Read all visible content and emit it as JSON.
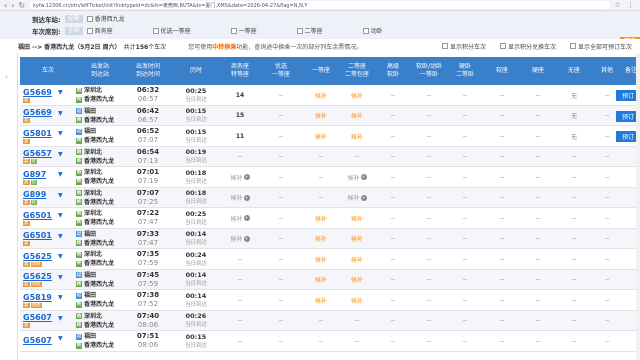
{
  "browser": {
    "url": "kyfw.12306.cn/otn/leftTicket/init?linktypeid=dc&fs=東莞西,BUTA&ts=夏门,XMS&date=2026-04-27&flag=N,N,Y"
  },
  "filters": {
    "arrival_label": "到达车站:",
    "arrival_tag": "全部",
    "arrival_option": "香港西九龙",
    "seat_label": "车次席别:",
    "seat_tag": "全部",
    "seat_options": [
      "商务座",
      "优选一等座",
      "一等座",
      "二等座",
      "动卧"
    ],
    "filter_button": "筛选"
  },
  "summary": {
    "route": "福田 --> 香港西九龙（5月2日 周六）",
    "count_prefix": "共计",
    "count": "156",
    "count_suffix": "个车次",
    "tip_prefix": "您可使用",
    "tip_highlight": "中转换乘",
    "tip_suffix": "功能，查询途中换乘一次的部分列车余票情况。",
    "options": [
      "显示积分车次",
      "显示积分兑换车次",
      "显示全部可预订车次"
    ]
  },
  "columns": [
    "车次",
    "出发站\n到达站",
    "出发时间\n到达时间",
    "历时",
    "商务座\n特等座",
    "优选\n一等座",
    "一等座",
    "二等座\n二等包座",
    "高级\n软卧",
    "软卧/动卧\n一等卧",
    "硬卧\n二等卧",
    "软座",
    "硬座",
    "无座",
    "其他",
    "备注"
  ],
  "rows": [
    {
      "train": "G5669",
      "tags": [
        "复"
      ],
      "from": "深圳北",
      "to": "香港西九龙",
      "dep": "06:32",
      "arr": "06:57",
      "dur": "00:25",
      "day": "当日到达",
      "seats": [
        "14",
        "--",
        "候补",
        "候补",
        "--",
        "--",
        "--",
        "--",
        "--",
        "无",
        "--"
      ],
      "book": "预订"
    },
    {
      "train": "G5669",
      "tags": [
        "复"
      ],
      "from": "福田",
      "to": "香港西九龙",
      "dep": "06:42",
      "arr": "06:57",
      "dur": "00:15",
      "day": "当日到达",
      "seats": [
        "15",
        "--",
        "候补",
        "候补",
        "--",
        "--",
        "--",
        "--",
        "--",
        "无",
        "--"
      ],
      "book": "预订"
    },
    {
      "train": "G5801",
      "tags": [
        "复"
      ],
      "from": "福田",
      "to": "香港西九龙",
      "dep": "06:52",
      "arr": "07:07",
      "dur": "00:15",
      "day": "当日到达",
      "seats": [
        "11",
        "--",
        "候补",
        "候补",
        "--",
        "--",
        "--",
        "--",
        "--",
        "无",
        "--"
      ],
      "book": "预订"
    },
    {
      "train": "G5657",
      "tags": [
        "复",
        "智"
      ],
      "from": "深圳北",
      "to": "香港西九龙",
      "dep": "06:54",
      "arr": "07:13",
      "dur": "00:19",
      "day": "当日到达",
      "seats": [
        "--",
        "--",
        "--",
        "--",
        "--",
        "--",
        "--",
        "--",
        "--",
        "--",
        "--"
      ],
      "book": ""
    },
    {
      "train": "G897",
      "tags": [
        "复",
        "智"
      ],
      "from": "深圳北",
      "to": "香港西九龙",
      "dep": "07:01",
      "arr": "07:19",
      "dur": "00:18",
      "day": "当日到达",
      "seats": [
        "候补",
        "--",
        "--",
        "候补",
        "--",
        "--",
        "--",
        "--",
        "--",
        "--",
        "--"
      ],
      "book": ""
    },
    {
      "train": "G899",
      "tags": [
        "复",
        "智"
      ],
      "from": "深圳北",
      "to": "香港西九龙",
      "dep": "07:07",
      "arr": "07:25",
      "dur": "00:18",
      "day": "当日到达",
      "seats": [
        "候补",
        "--",
        "--",
        "候补",
        "--",
        "--",
        "--",
        "--",
        "--",
        "--",
        "--"
      ],
      "book": ""
    },
    {
      "train": "G6501",
      "tags": [
        "复"
      ],
      "from": "深圳北",
      "to": "香港西九龙",
      "dep": "07:22",
      "arr": "07:47",
      "dur": "00:25",
      "day": "当日到达",
      "seats": [
        "候补",
        "--",
        "候补",
        "候补",
        "--",
        "--",
        "--",
        "--",
        "--",
        "--",
        "--"
      ],
      "book": ""
    },
    {
      "train": "G6501",
      "tags": [
        "复"
      ],
      "from": "福田",
      "to": "香港西九龙",
      "dep": "07:33",
      "arr": "07:47",
      "dur": "00:14",
      "day": "当日到达",
      "seats": [
        "候补",
        "--",
        "候补",
        "候补",
        "--",
        "--",
        "--",
        "--",
        "--",
        "--",
        "--"
      ],
      "book": ""
    },
    {
      "train": "G5625",
      "tags": [
        "复",
        "动感"
      ],
      "from": "深圳北",
      "to": "香港西九龙",
      "dep": "07:35",
      "arr": "07:59",
      "dur": "00:24",
      "day": "当日到达",
      "seats": [
        "--",
        "--",
        "候补",
        "候补",
        "--",
        "--",
        "--",
        "--",
        "--",
        "--",
        "--"
      ],
      "book": ""
    },
    {
      "train": "G5625",
      "tags": [
        "复",
        "动感"
      ],
      "from": "福田",
      "to": "香港西九龙",
      "dep": "07:45",
      "arr": "07:59",
      "dur": "00:14",
      "day": "当日到达",
      "seats": [
        "--",
        "--",
        "候补",
        "候补",
        "--",
        "--",
        "--",
        "--",
        "--",
        "--",
        "--"
      ],
      "book": ""
    },
    {
      "train": "G5819",
      "tags": [
        "复",
        "动感"
      ],
      "from": "福田",
      "to": "香港西九龙",
      "dep": "07:38",
      "arr": "07:52",
      "dur": "00:14",
      "day": "当日到达",
      "seats": [
        "--",
        "--",
        "候补",
        "候补",
        "--",
        "--",
        "--",
        "--",
        "--",
        "--",
        "--"
      ],
      "book": ""
    },
    {
      "train": "G5607",
      "tags": [
        "复"
      ],
      "from": "深圳北",
      "to": "香港西九龙",
      "dep": "07:40",
      "arr": "08:06",
      "dur": "00:26",
      "day": "当日到达",
      "seats": [
        "--",
        "--",
        "--",
        "--",
        "--",
        "--",
        "--",
        "--",
        "--",
        "--",
        "--"
      ],
      "book": ""
    },
    {
      "train": "G5607",
      "tags": [],
      "from": "福田",
      "to": "香港西九龙",
      "dep": "07:51",
      "arr": "08:06",
      "dur": "00:15",
      "day": "当日到达",
      "seats": [
        "--",
        "--",
        "--",
        "--",
        "--",
        "--",
        "--",
        "--",
        "--",
        "--",
        "--"
      ],
      "book": ""
    }
  ]
}
